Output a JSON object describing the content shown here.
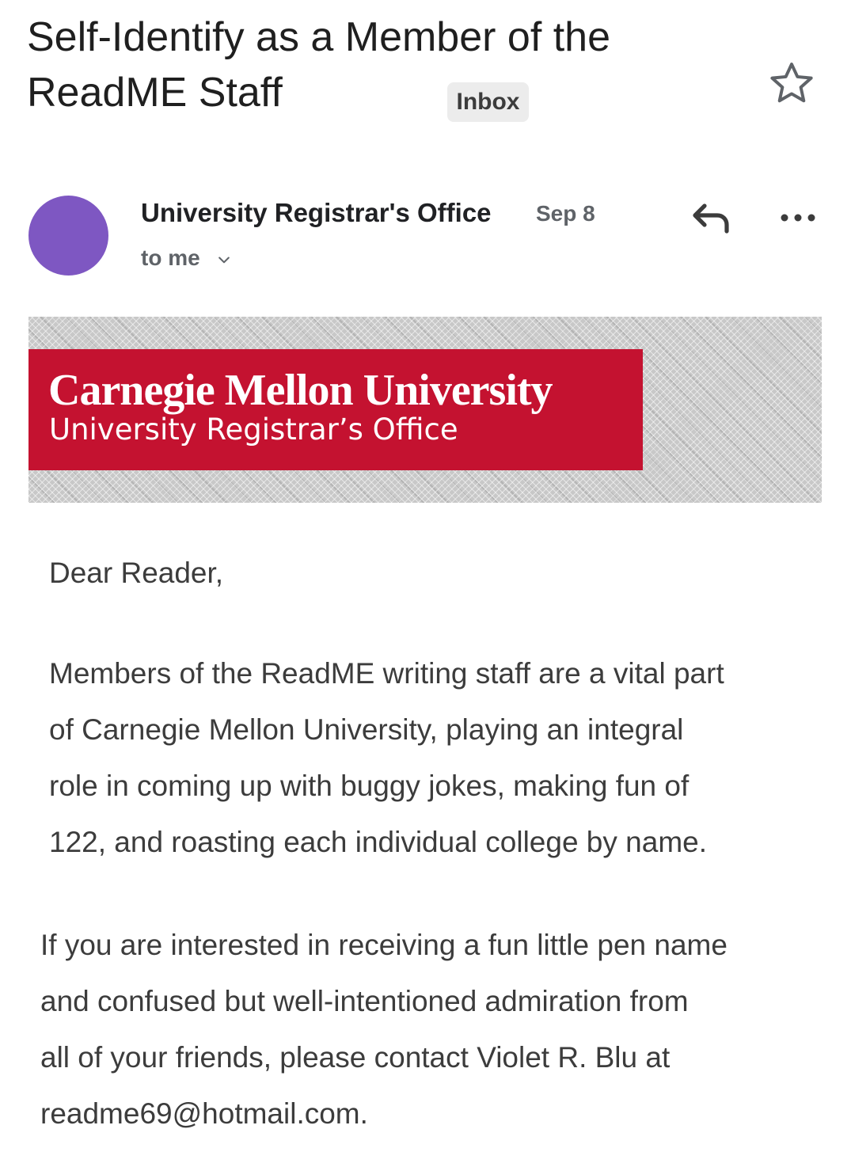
{
  "email": {
    "subject_lines": [
      "Self-Identify as a Member of the",
      "ReadME Staff"
    ],
    "label": "Inbox",
    "sender": "University Registrar's Office",
    "date": "Sep 8",
    "recipient": "to me"
  },
  "icons": {
    "star": "star-outline-icon",
    "reply": "reply-icon",
    "more": "more-horizontal-icon",
    "expand": "chevron-down-icon"
  },
  "colors": {
    "avatar": "#7e57c2",
    "banner_red": "#c41230",
    "banner_gray": "#c8c8c8"
  },
  "banner": {
    "title": "Carnegie Mellon University",
    "subtitle": "University Registrar’s Office"
  },
  "body": {
    "greeting": "Dear Reader,",
    "paragraph1_lines": [
      "Members of the ReadME writing staff are a vital part",
      "of Carnegie Mellon University, playing an integral",
      "role in coming up with buggy jokes, making fun of",
      "122, and roasting each individual college by name."
    ],
    "paragraph2_lines": [
      "If you are interested in receiving a fun little pen name",
      "and confused but well-intentioned admiration from",
      "all of your friends, please contact Violet R. Blu at",
      "readme69@hotmail.com."
    ]
  }
}
